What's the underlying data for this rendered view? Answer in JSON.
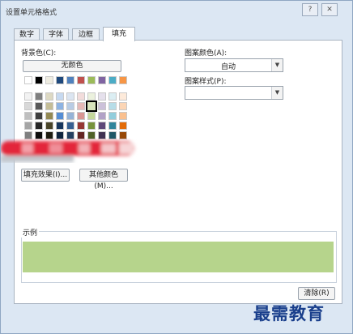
{
  "window": {
    "title": "设置单元格格式",
    "help": "?",
    "close": "✕"
  },
  "tabs": [
    {
      "label": "数字"
    },
    {
      "label": "字体"
    },
    {
      "label": "边框"
    },
    {
      "label": "填充",
      "active": true
    }
  ],
  "background": {
    "label": "背景色(C):",
    "no_color_button": "无颜色",
    "fill_effects_button": "填充效果(I)...",
    "more_colors_button": "其他颜色(M)...",
    "top_row": [
      "#ffffff",
      "#000000",
      "#eeece1",
      "#1f497d",
      "#4f81bd",
      "#c0504d",
      "#9bbb59",
      "#8064a2",
      "#4bacc6",
      "#f79646"
    ],
    "grid": [
      [
        "#f2f2f2",
        "#7f7f7f",
        "#ddd9c3",
        "#c6d9f0",
        "#dbe5f1",
        "#f2dcdb",
        "#ebf1dd",
        "#e5e0ec",
        "#dbeef3",
        "#fdeada"
      ],
      [
        "#d8d8d8",
        "#595959",
        "#c4bd97",
        "#8db3e2",
        "#b8cce4",
        "#e5b9b7",
        "#d7e3bc",
        "#ccc1d9",
        "#b7dde8",
        "#fbd5b5"
      ],
      [
        "#bfbfbf",
        "#3f3f3f",
        "#938953",
        "#548dd4",
        "#95b3d7",
        "#d99694",
        "#c3d69b",
        "#b2a2c7",
        "#92cddc",
        "#fac08f"
      ],
      [
        "#a5a5a5",
        "#262626",
        "#494429",
        "#17365d",
        "#366092",
        "#953734",
        "#76923c",
        "#5f497a",
        "#31859b",
        "#e36c09"
      ],
      [
        "#7f7f7f",
        "#0c0c0c",
        "#1d1b10",
        "#0f243e",
        "#244061",
        "#632423",
        "#4f6128",
        "#3f3151",
        "#205867",
        "#974806"
      ]
    ],
    "selected_swatch": "#d7e3bc"
  },
  "pattern": {
    "color_label": "图案颜色(A):",
    "color_value": "自动",
    "style_label": "图案样式(P):",
    "style_value": ""
  },
  "sample": {
    "label": "示例",
    "color": "#b6d48c"
  },
  "footer": {
    "clear_button": "清除(R)"
  },
  "watermark": {
    "text": "最需教育"
  },
  "colors": {
    "accent_border": "#8fa6c2",
    "selected_outline": "#000000"
  }
}
